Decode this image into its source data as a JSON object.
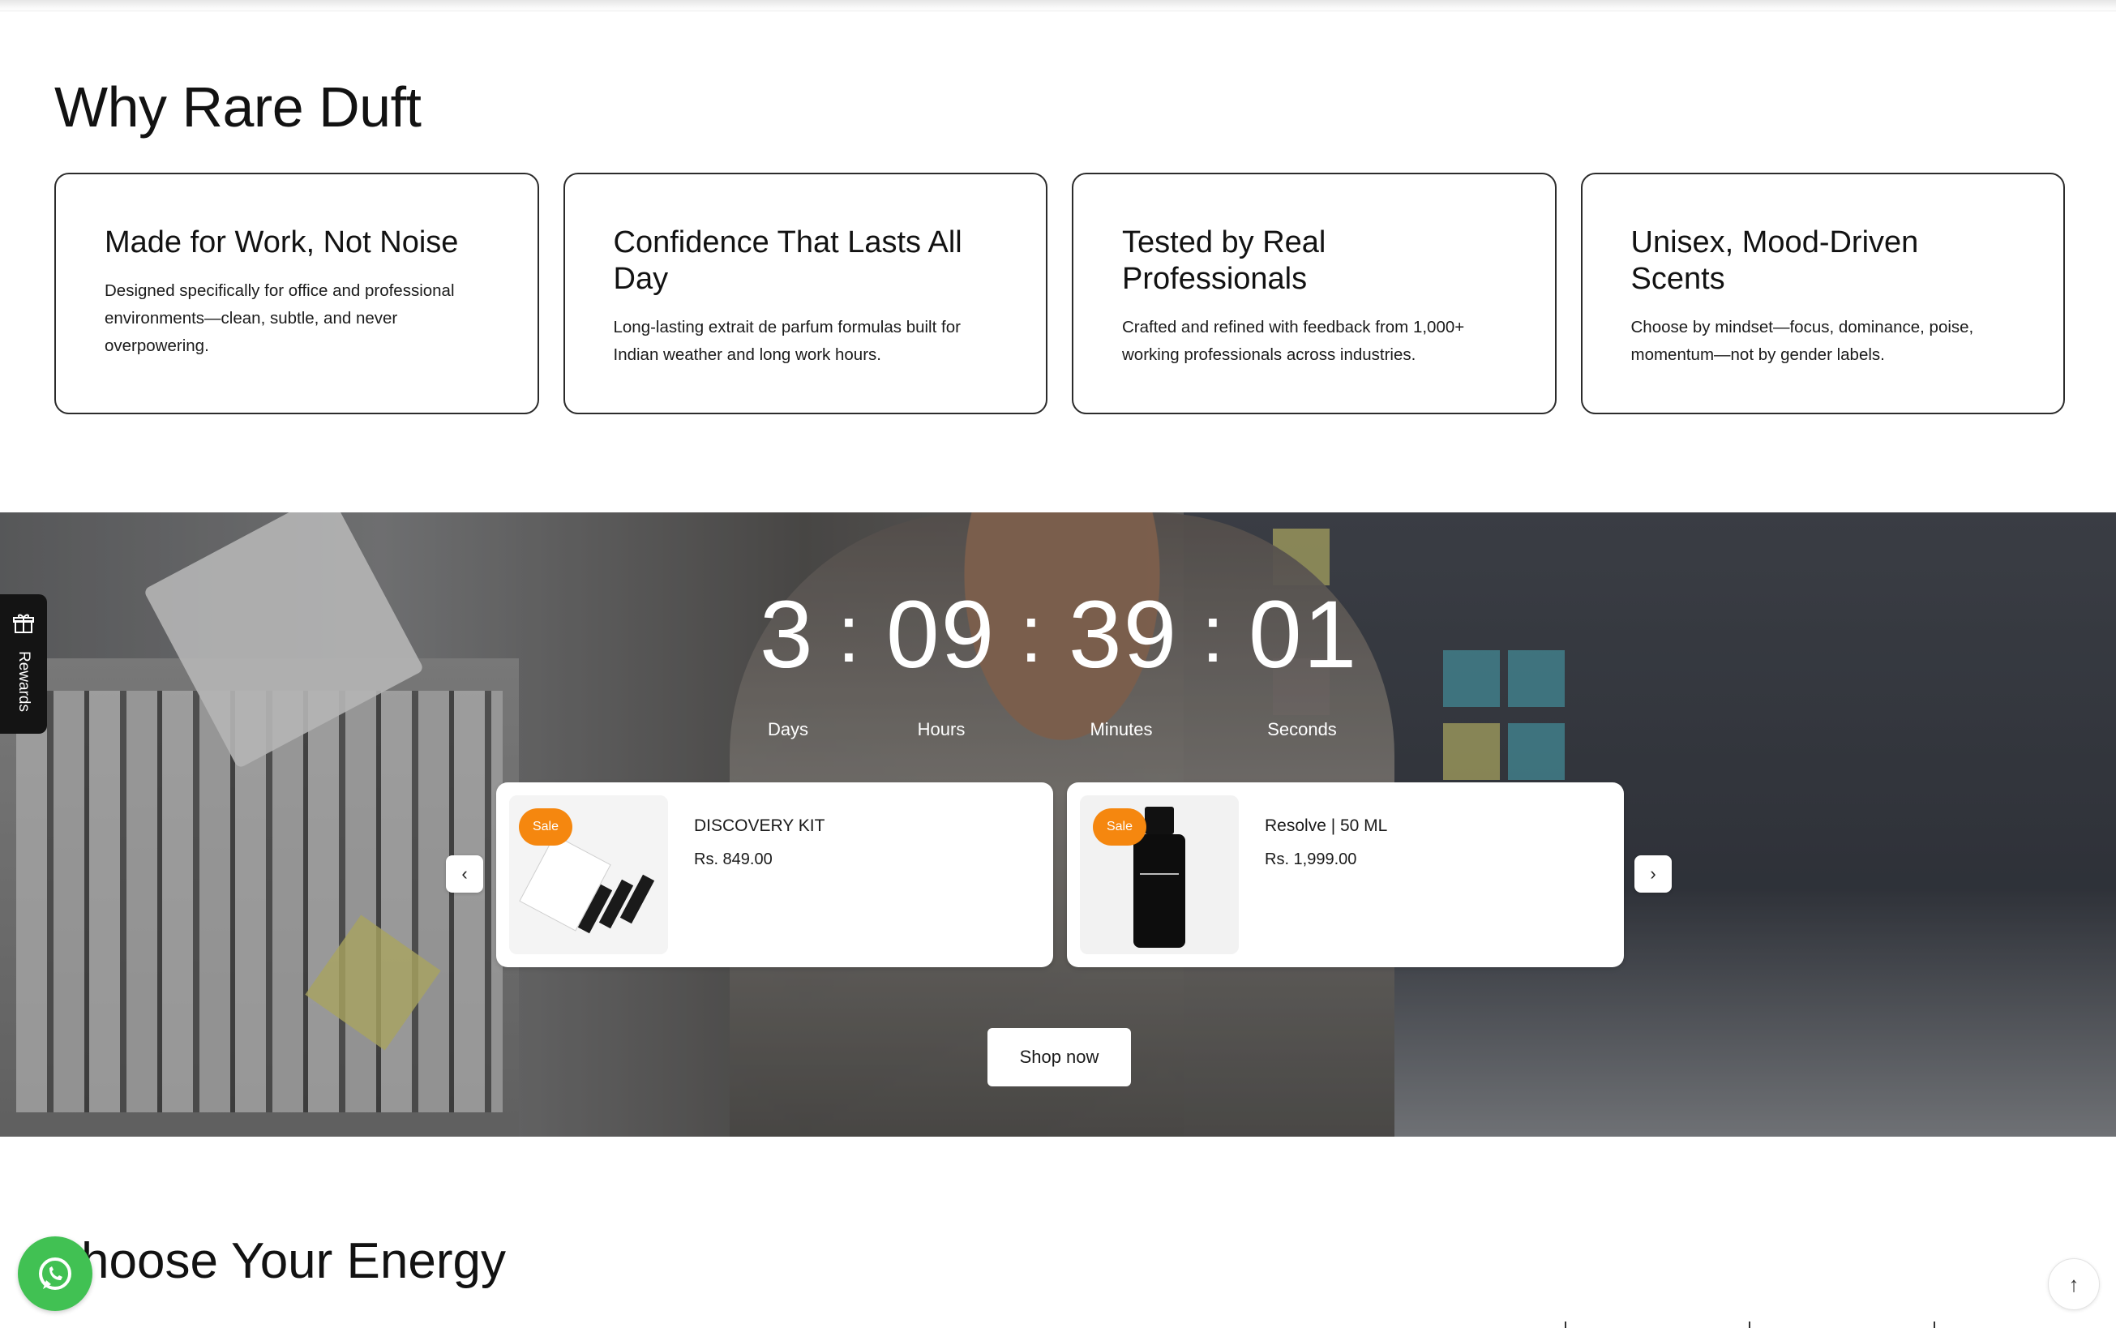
{
  "why_section": {
    "title": "Why Rare Duft",
    "cards": [
      {
        "title": "Made for Work, Not Noise",
        "text": "Designed specifically for office and professional environments—clean, subtle, and never overpowering."
      },
      {
        "title": "Confidence That Lasts All Day",
        "text": "Long-lasting extrait de parfum formulas built for Indian weather and long work hours."
      },
      {
        "title": "Tested by Real Professionals",
        "text": "Crafted and refined with feedback from 1,000+ working professionals across industries."
      },
      {
        "title": "Unisex, Mood-Driven Scents",
        "text": "Choose by mindset—focus, dominance, poise, momentum—not by gender labels."
      }
    ]
  },
  "countdown": {
    "days": "3",
    "hours": "09",
    "minutes": "39",
    "seconds": "01",
    "separator": ":",
    "labels": {
      "days": "Days",
      "hours": "Hours",
      "minutes": "Minutes",
      "seconds": "Seconds"
    }
  },
  "products": [
    {
      "name": "DISCOVERY KIT",
      "price": "Rs. 849.00",
      "badge": "Sale"
    },
    {
      "name": "Resolve | 50 ML",
      "price": "Rs. 1,999.00",
      "badge": "Sale"
    }
  ],
  "shop_button": "Shop now",
  "rewards": {
    "label": "Rewards"
  },
  "choose_section": {
    "title": "hoose Your Energy"
  },
  "colors": {
    "sale": "#f5870f",
    "whatsapp": "#41c153",
    "dark": "#141414"
  }
}
